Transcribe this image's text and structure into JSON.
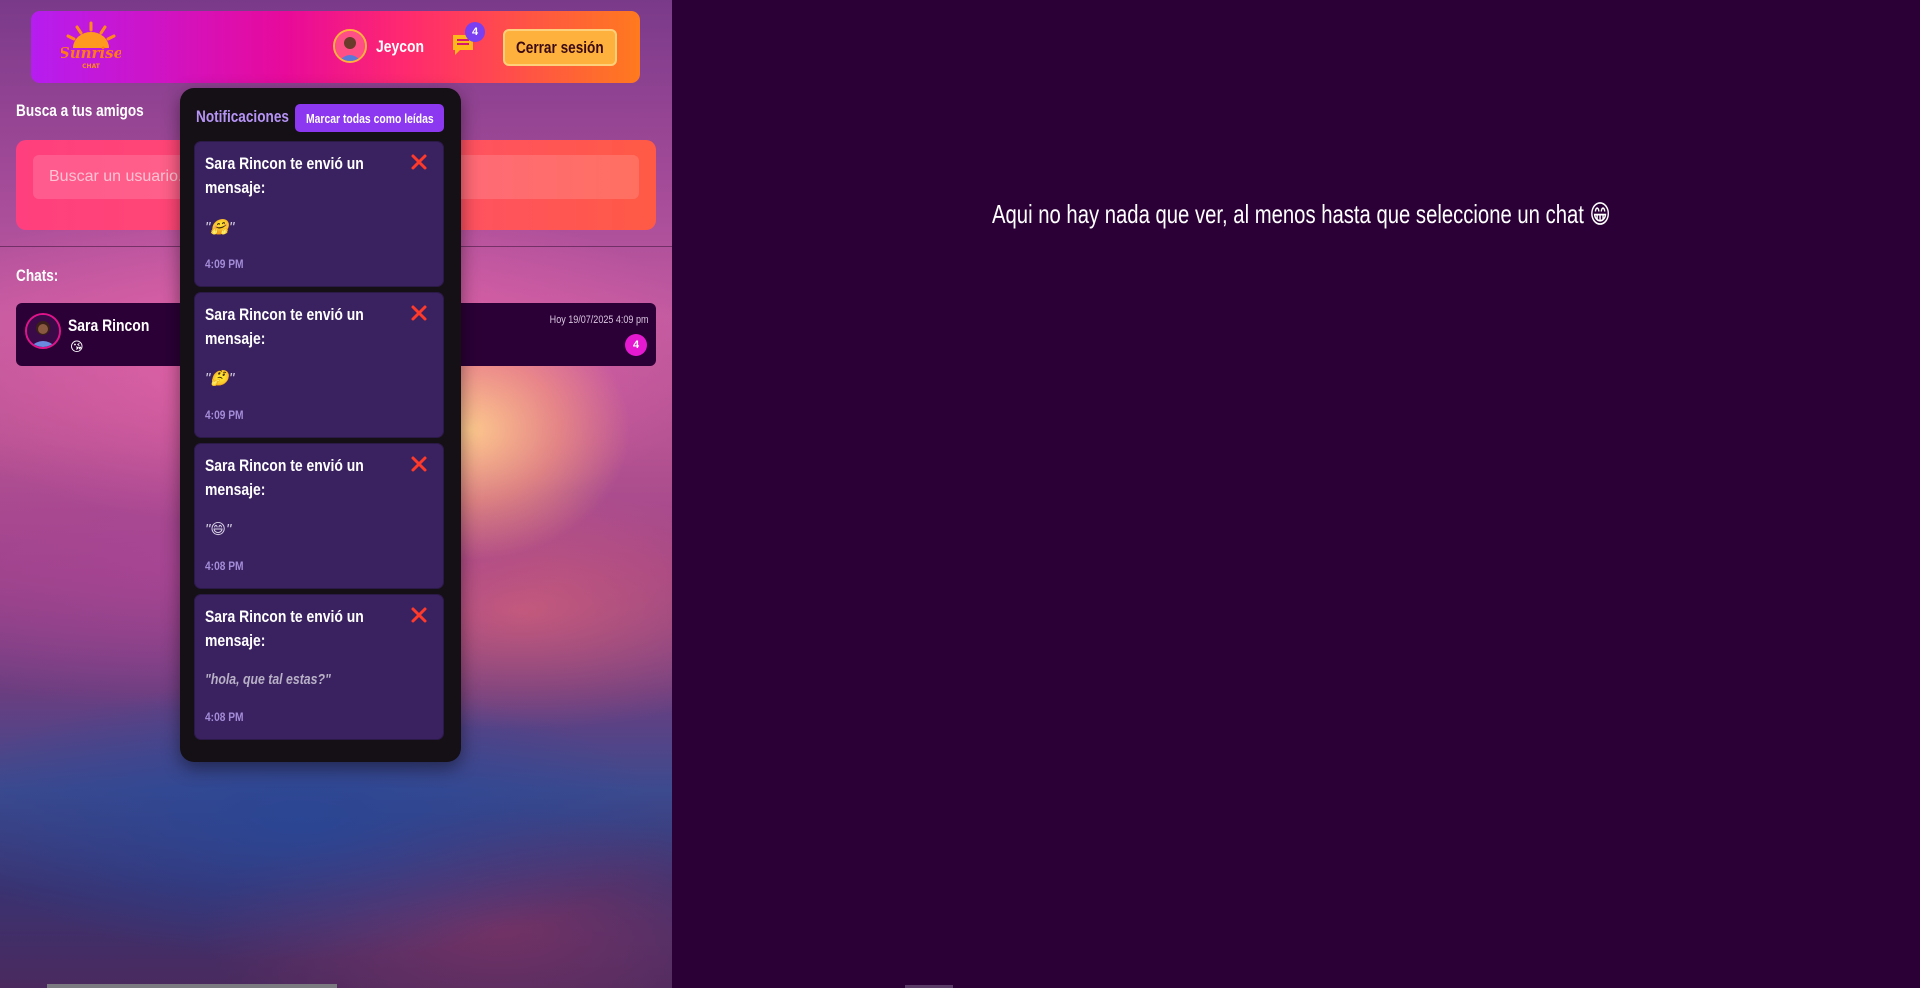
{
  "header": {
    "logo_text": "Sunrise",
    "logo_sub": "CHAT",
    "username": "Jeycon",
    "notif_count": "4",
    "logout_label": "Cerrar sesión"
  },
  "search": {
    "title": "Busca a tus amigos",
    "placeholder": "Buscar un usuario..."
  },
  "chats": {
    "title": "Chats:",
    "items": [
      {
        "name": "Sara Rincon",
        "last_message": "😘",
        "date": "Hoy 19/07/2025 4:09 pm",
        "unread": "4"
      }
    ]
  },
  "notifications": {
    "title": "Notificaciones",
    "mark_all_label": "Marcar todas como leídas",
    "items": [
      {
        "text": "Sara Rincon te envió un mensaje:",
        "message": "\"🤗\"",
        "time": "4:09 PM"
      },
      {
        "text": "Sara Rincon te envió un mensaje:",
        "message": "\"🤔\"",
        "time": "4:09 PM"
      },
      {
        "text": "Sara Rincon te envió un mensaje:",
        "message": "\"😄\"",
        "time": "4:08 PM"
      },
      {
        "text": "Sara Rincon te envió un mensaje:",
        "message": "\"hola, que tal estas?\"",
        "time": "4:08 PM"
      }
    ]
  },
  "main": {
    "placeholder": "Aqui no hay nada que ver, al menos hasta que seleccione un chat 😁"
  },
  "colors": {
    "bg_dark": "#2b0036",
    "accent_purple": "#8c38f0",
    "accent_orange": "#ffb13d",
    "close_red": "#ff3a2a"
  }
}
